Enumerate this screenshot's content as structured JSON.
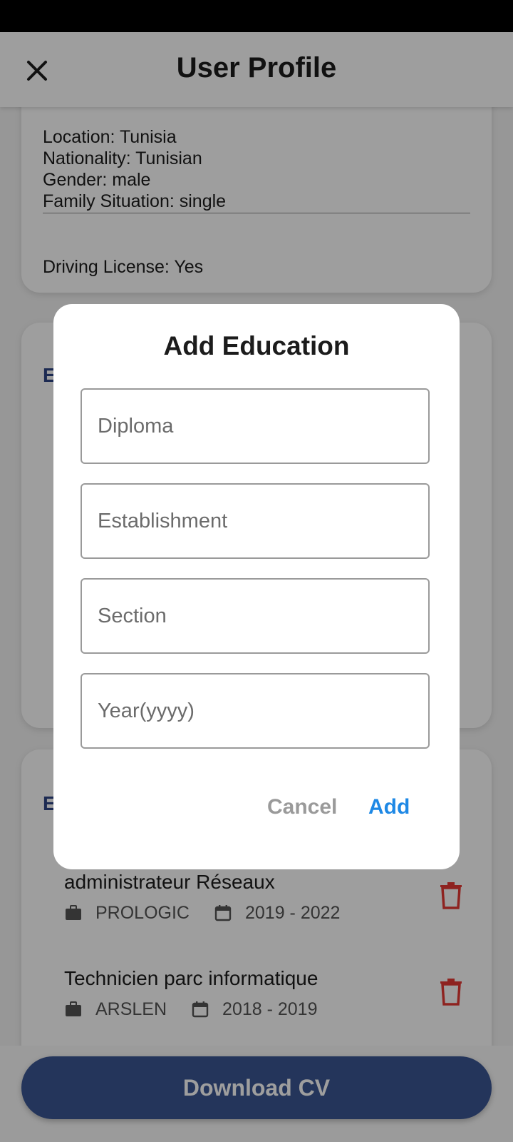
{
  "app": {
    "title": "User Profile"
  },
  "profile": {
    "location": "Location: Tunisia",
    "nationality": "Nationality: Tunisian",
    "gender": "Gender: male",
    "family": "Family Situation: single",
    "driving": "Driving License: Yes"
  },
  "sections": {
    "education_initial": "E",
    "experience_initial": "E"
  },
  "experiences": [
    {
      "title": "administrateur Réseaux",
      "company": "PROLOGIC",
      "period": "2019 - 2022"
    },
    {
      "title": "Technicien parc informatique",
      "company": "ARSLEN",
      "period": "2018 - 2019"
    }
  ],
  "bottom": {
    "download_label": "Download CV"
  },
  "dialog": {
    "title": "Add Education",
    "diploma_placeholder": "Diploma",
    "establishment_placeholder": "Establishment",
    "section_placeholder": "Section",
    "year_placeholder": "Year(yyyy)",
    "cancel_label": "Cancel",
    "add_label": "Add"
  },
  "colors": {
    "primary": "#3b5693",
    "accent": "#1e88e5",
    "danger": "#e53935"
  }
}
